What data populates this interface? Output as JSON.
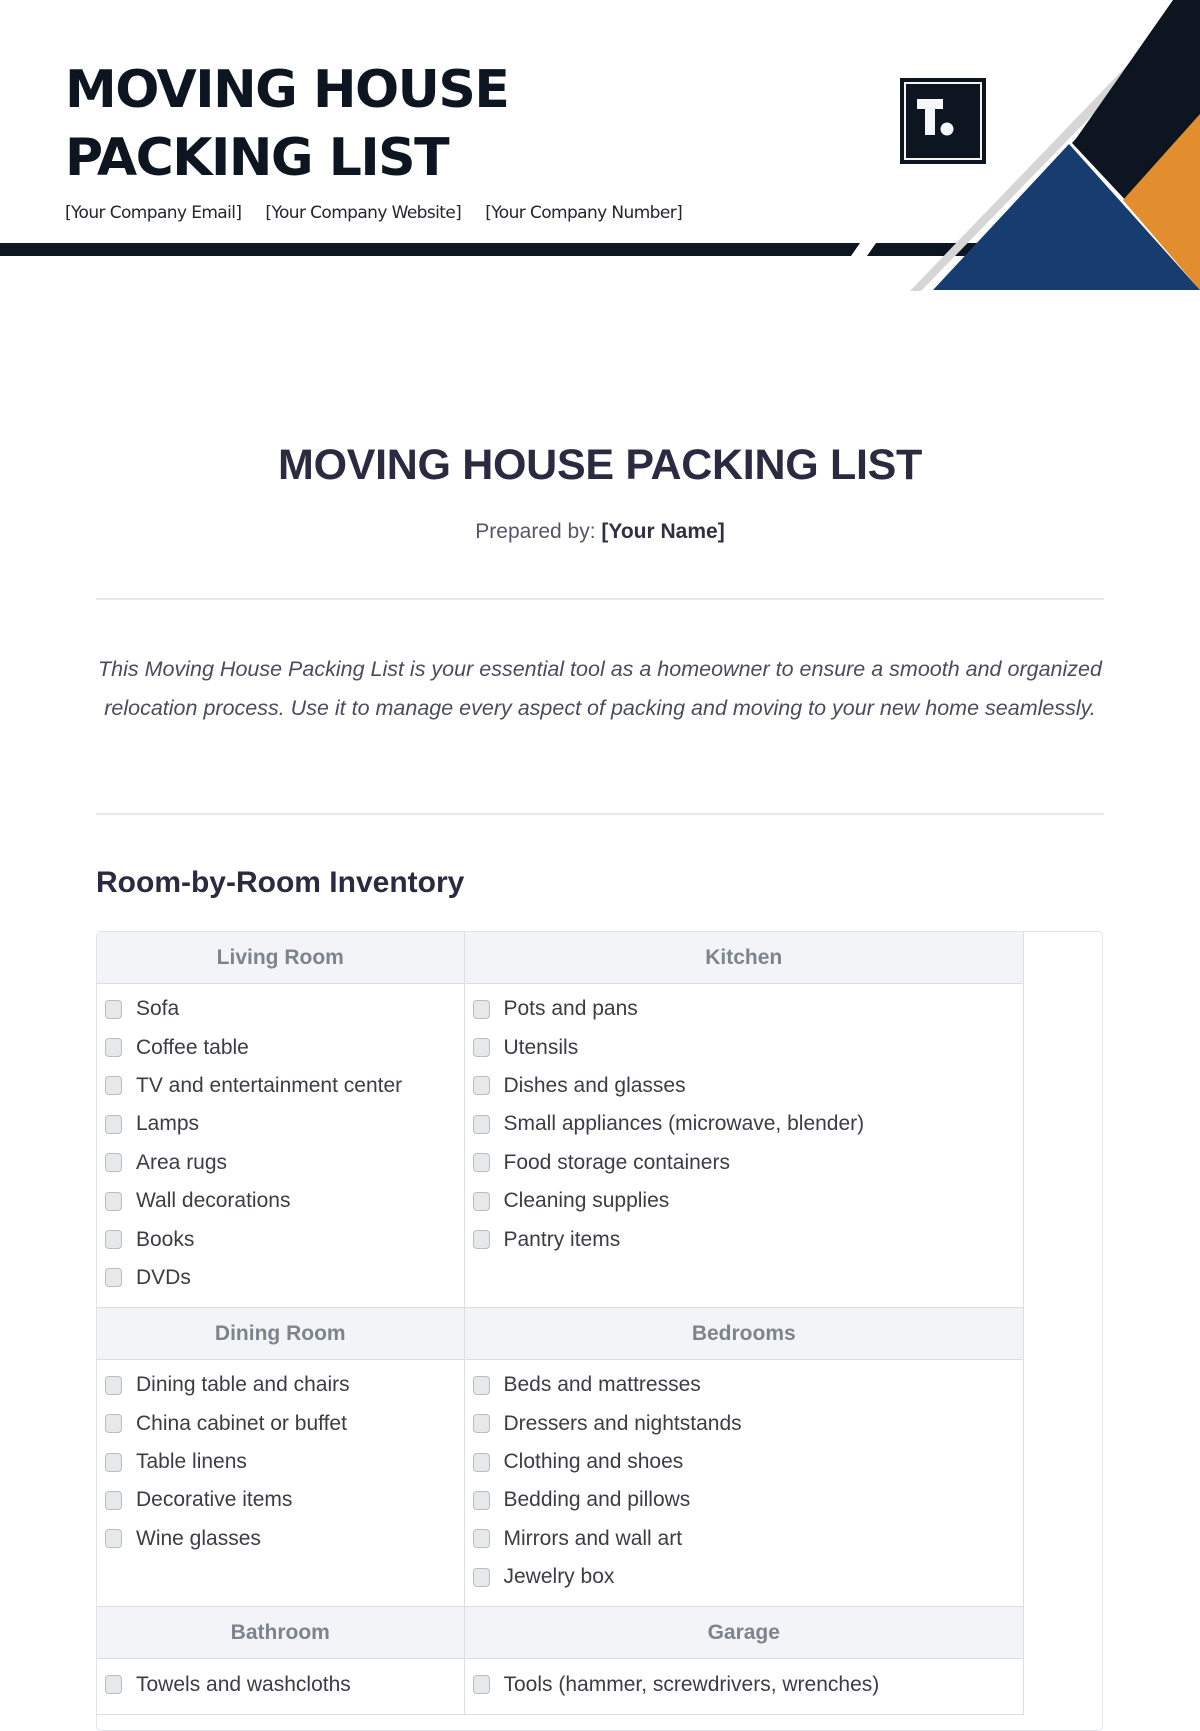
{
  "header": {
    "title_line1": "MOVING HOUSE",
    "title_line2": "PACKING LIST",
    "contacts": [
      "[Your Company Email]",
      "[Your Company Website]",
      "[Your Company Number]"
    ],
    "logo_letter": "T.",
    "colors": {
      "navy": "#0d1520",
      "blue": "#163c70",
      "orange": "#e28e2e",
      "gray_stripe": "#d6d6d6"
    }
  },
  "document": {
    "title": "MOVING HOUSE PACKING LIST",
    "prepared_by_label": "Prepared by:",
    "prepared_by_value": "[Your Name]",
    "intro": "This Moving House Packing List is your essential tool as a homeowner to ensure a smooth and organized relocation process. Use it to manage every aspect of packing and moving to your new home seamlessly."
  },
  "inventory": {
    "section_title": "Room-by-Room Inventory",
    "rows": [
      {
        "left": {
          "room": "Living Room",
          "items": [
            "Sofa",
            "Coffee table",
            "TV and entertainment center",
            "Lamps",
            "Area rugs",
            "Wall decorations",
            "Books",
            "DVDs"
          ]
        },
        "right": {
          "room": "Kitchen",
          "items": [
            "Pots and pans",
            "Utensils",
            "Dishes and glasses",
            "Small appliances (microwave, blender)",
            "Food storage containers",
            "Cleaning supplies",
            "Pantry items"
          ]
        }
      },
      {
        "left": {
          "room": "Dining Room",
          "items": [
            "Dining table and chairs",
            "China cabinet or buffet",
            "Table linens",
            "Decorative items",
            "Wine glasses"
          ]
        },
        "right": {
          "room": "Bedrooms",
          "items": [
            "Beds and mattresses",
            "Dressers and nightstands",
            "Clothing and shoes",
            "Bedding and pillows",
            "Mirrors and wall art",
            "Jewelry box"
          ]
        }
      },
      {
        "left": {
          "room": "Bathroom",
          "items": [
            "Towels and washcloths"
          ]
        },
        "right": {
          "room": "Garage",
          "items": [
            "Tools (hammer, screwdrivers, wrenches)"
          ]
        }
      }
    ]
  }
}
